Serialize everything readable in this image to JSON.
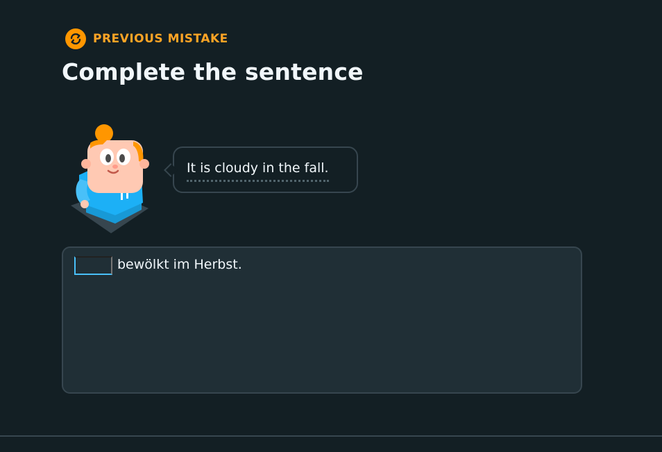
{
  "header": {
    "badge_icon": "repeat-icon",
    "badge_label": "PREVIOUS MISTAKE",
    "badge_color": "#ff9600",
    "title": "Complete the sentence"
  },
  "prompt": {
    "character": "student-character",
    "speech_text": "It is cloudy in the fall."
  },
  "answer": {
    "blank_value": "",
    "sentence_rest": "bewölkt im Herbst.",
    "accent_color": "#49c0f8"
  },
  "colors": {
    "background": "#131f24",
    "panel": "#202f36",
    "border": "#37464f",
    "text": "#f1f7fb"
  }
}
